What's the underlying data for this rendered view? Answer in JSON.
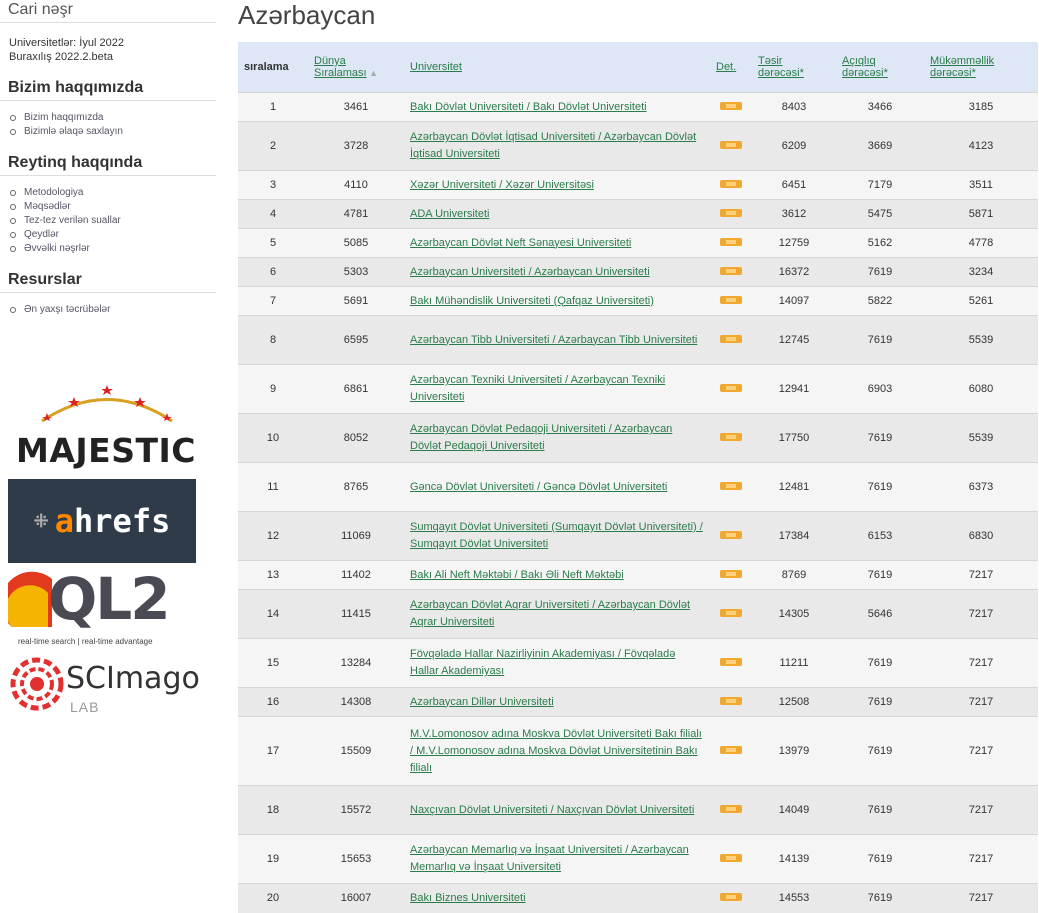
{
  "sidebar": {
    "current_edition_title": "Cari nəşr",
    "universities_line": "Universitetlər: İyul 2022",
    "release_line": "Buraxılış 2022.2.beta",
    "about_title": "Bizim haqqımızda",
    "about_items": [
      "Bizim haqqımızda",
      "Bizimlə əlaqə saxlayın"
    ],
    "ranking_title": "Reytinq haqqında",
    "ranking_items": [
      "Metodologiya",
      "Məqsədlər",
      "Tez-tez verilən suallar",
      "Qeydlər",
      "Əvvəlki nəşrlər"
    ],
    "resources_title": "Resurslar",
    "resources_items": [
      "Ən yaxşı təcrübələr"
    ],
    "logos": {
      "majestic": "MAJESTIC",
      "ahrefs_a": "a",
      "ahrefs_rest": "hrefs",
      "ql2": "QL2",
      "ql2_tagline": "real-time search | real-time advantage",
      "scimago": "SCImago",
      "scimago_lab": "LAB"
    }
  },
  "main": {
    "title": "Azərbaycan",
    "columns": {
      "rank": "sıralama",
      "world_rank": "Dünya Sıralaması",
      "university": "Universitet",
      "det": "Det.",
      "impact": "Təsir dərəcəsi*",
      "openness": "Açıqlıq dərəcəsi*",
      "excellence": "Mükəmməllik dərəcəsi*"
    },
    "rows": [
      {
        "rank": "1",
        "world": "3461",
        "name": "Bakı Dövlət Universiteti / Bakı Dövlət Universiteti",
        "impact": "8403",
        "open": "3466",
        "exc": "3185"
      },
      {
        "rank": "2",
        "world": "3728",
        "name": "Azərbaycan Dövlət İqtisad Universiteti / Azərbaycan Dövlət İqtisad Universiteti",
        "impact": "6209",
        "open": "3669",
        "exc": "4123"
      },
      {
        "rank": "3",
        "world": "4110",
        "name": "Xəzər Universiteti / Xəzər Universitəsi",
        "impact": "6451",
        "open": "7179",
        "exc": "3511"
      },
      {
        "rank": "4",
        "world": "4781",
        "name": "ADA Universiteti",
        "impact": "3612",
        "open": "5475",
        "exc": "5871"
      },
      {
        "rank": "5",
        "world": "5085",
        "name": "Azərbaycan Dövlət Neft Sənayesi Universiteti",
        "impact": "12759",
        "open": "5162",
        "exc": "4778"
      },
      {
        "rank": "6",
        "world": "5303",
        "name": "Azərbaycan Universiteti / Azərbaycan Universiteti",
        "impact": "16372",
        "open": "7619",
        "exc": "3234"
      },
      {
        "rank": "7",
        "world": "5691",
        "name": "Bakı Mühəndislik Universiteti (Qafqaz Universiteti)",
        "impact": "14097",
        "open": "5822",
        "exc": "5261"
      },
      {
        "rank": "8",
        "world": "6595",
        "name": "Azərbaycan Tibb Universiteti / Azərbaycan Tibb Universiteti",
        "impact": "12745",
        "open": "7619",
        "exc": "5539"
      },
      {
        "rank": "9",
        "world": "6861",
        "name": "Azərbaycan Texniki Universiteti / Azərbaycan Texniki Universiteti",
        "impact": "12941",
        "open": "6903",
        "exc": "6080"
      },
      {
        "rank": "10",
        "world": "8052",
        "name": "Azərbaycan Dövlət Pedaqoji Universiteti / Azərbaycan Dövlət Pedaqoji Universiteti",
        "impact": "17750",
        "open": "7619",
        "exc": "5539"
      },
      {
        "rank": "11",
        "world": "8765",
        "name": "Gəncə Dövlət Universiteti / Gəncə Dövlət Universiteti",
        "impact": "12481",
        "open": "7619",
        "exc": "6373"
      },
      {
        "rank": "12",
        "world": "11069",
        "name": "Sumqayıt Dövlət Universiteti (Sumqayıt Dövlət Universiteti) / Sumqayıt Dövlət Universiteti",
        "impact": "17384",
        "open": "6153",
        "exc": "6830"
      },
      {
        "rank": "13",
        "world": "11402",
        "name": "Bakı Ali Neft Məktəbi / Bakı Əli Neft Məktəbi",
        "impact": "8769",
        "open": "7619",
        "exc": "7217"
      },
      {
        "rank": "14",
        "world": "11415",
        "name": "Azərbaycan Dövlət Aqrar Universiteti / Azərbaycan Dövlət Aqrar Universiteti",
        "impact": "14305",
        "open": "5646",
        "exc": "7217"
      },
      {
        "rank": "15",
        "world": "13284",
        "name": "Fövqəladə Hallar Nazirliyinin Akademiyası / Fövqəladə Hallar Akademiyası",
        "impact": "11211",
        "open": "7619",
        "exc": "7217"
      },
      {
        "rank": "16",
        "world": "14308",
        "name": "Azərbaycan Dillər Universiteti",
        "impact": "12508",
        "open": "7619",
        "exc": "7217"
      },
      {
        "rank": "17",
        "world": "15509",
        "name": "M.V.Lomonosov adına Moskva Dövlət Universiteti Bakı filialı / M.V.Lomonosov adına Moskva Dövlət Universitetinin Bakı filialı",
        "impact": "13979",
        "open": "7619",
        "exc": "7217"
      },
      {
        "rank": "18",
        "world": "15572",
        "name": "Naxçıvan Dövlət Universiteti / Naxçıvan Dövlət Universiteti",
        "impact": "14049",
        "open": "7619",
        "exc": "7217"
      },
      {
        "rank": "19",
        "world": "15653",
        "name": "Azərbaycan Memarlıq və İnşaat Universiteti / Azərbaycan Memarlıq və İnşaat Universiteti",
        "impact": "14139",
        "open": "7619",
        "exc": "7217"
      },
      {
        "rank": "20",
        "world": "16007",
        "name": "Bakı Biznes Universiteti",
        "impact": "14553",
        "open": "7619",
        "exc": "7217"
      }
    ]
  },
  "colors": {
    "link": "#2b7c4a",
    "header_bg": "#dde7f5",
    "row_odd": "#f5f5f5",
    "row_even": "#e9e9e9",
    "det_icon": "#f0a830"
  }
}
